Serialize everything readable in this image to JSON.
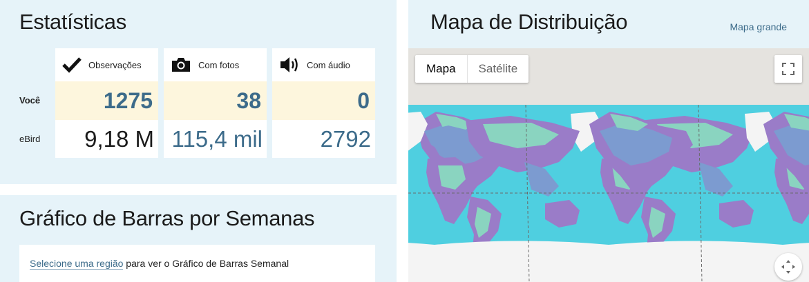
{
  "stats": {
    "title": "Estatísticas",
    "columns": [
      {
        "label": "Observações",
        "icon": "checkmark-icon",
        "you": "1275",
        "ebird": "9,18 M"
      },
      {
        "label": "Com fotos",
        "icon": "camera-icon",
        "you": "38",
        "ebird": "115,4 mil"
      },
      {
        "label": "Com áudio",
        "icon": "speaker-icon",
        "you": "0",
        "ebird": "2792"
      }
    ],
    "row_you": "Você",
    "row_ebird": "eBird"
  },
  "bar_chart": {
    "title": "Gráfico de Barras por Semanas",
    "link": "Selecione uma região",
    "text": " para ver o Gráfico de Barras Semanal"
  },
  "map": {
    "title": "Mapa de Distribuição",
    "big_link": "Mapa grande",
    "type_map": "Mapa",
    "type_sat": "Satélite"
  },
  "colors": {
    "panel_bg": "#e6f3f9",
    "accent": "#3c6b8a",
    "highlight": "#fdf6dd",
    "ocean": "#4fcfe0"
  }
}
